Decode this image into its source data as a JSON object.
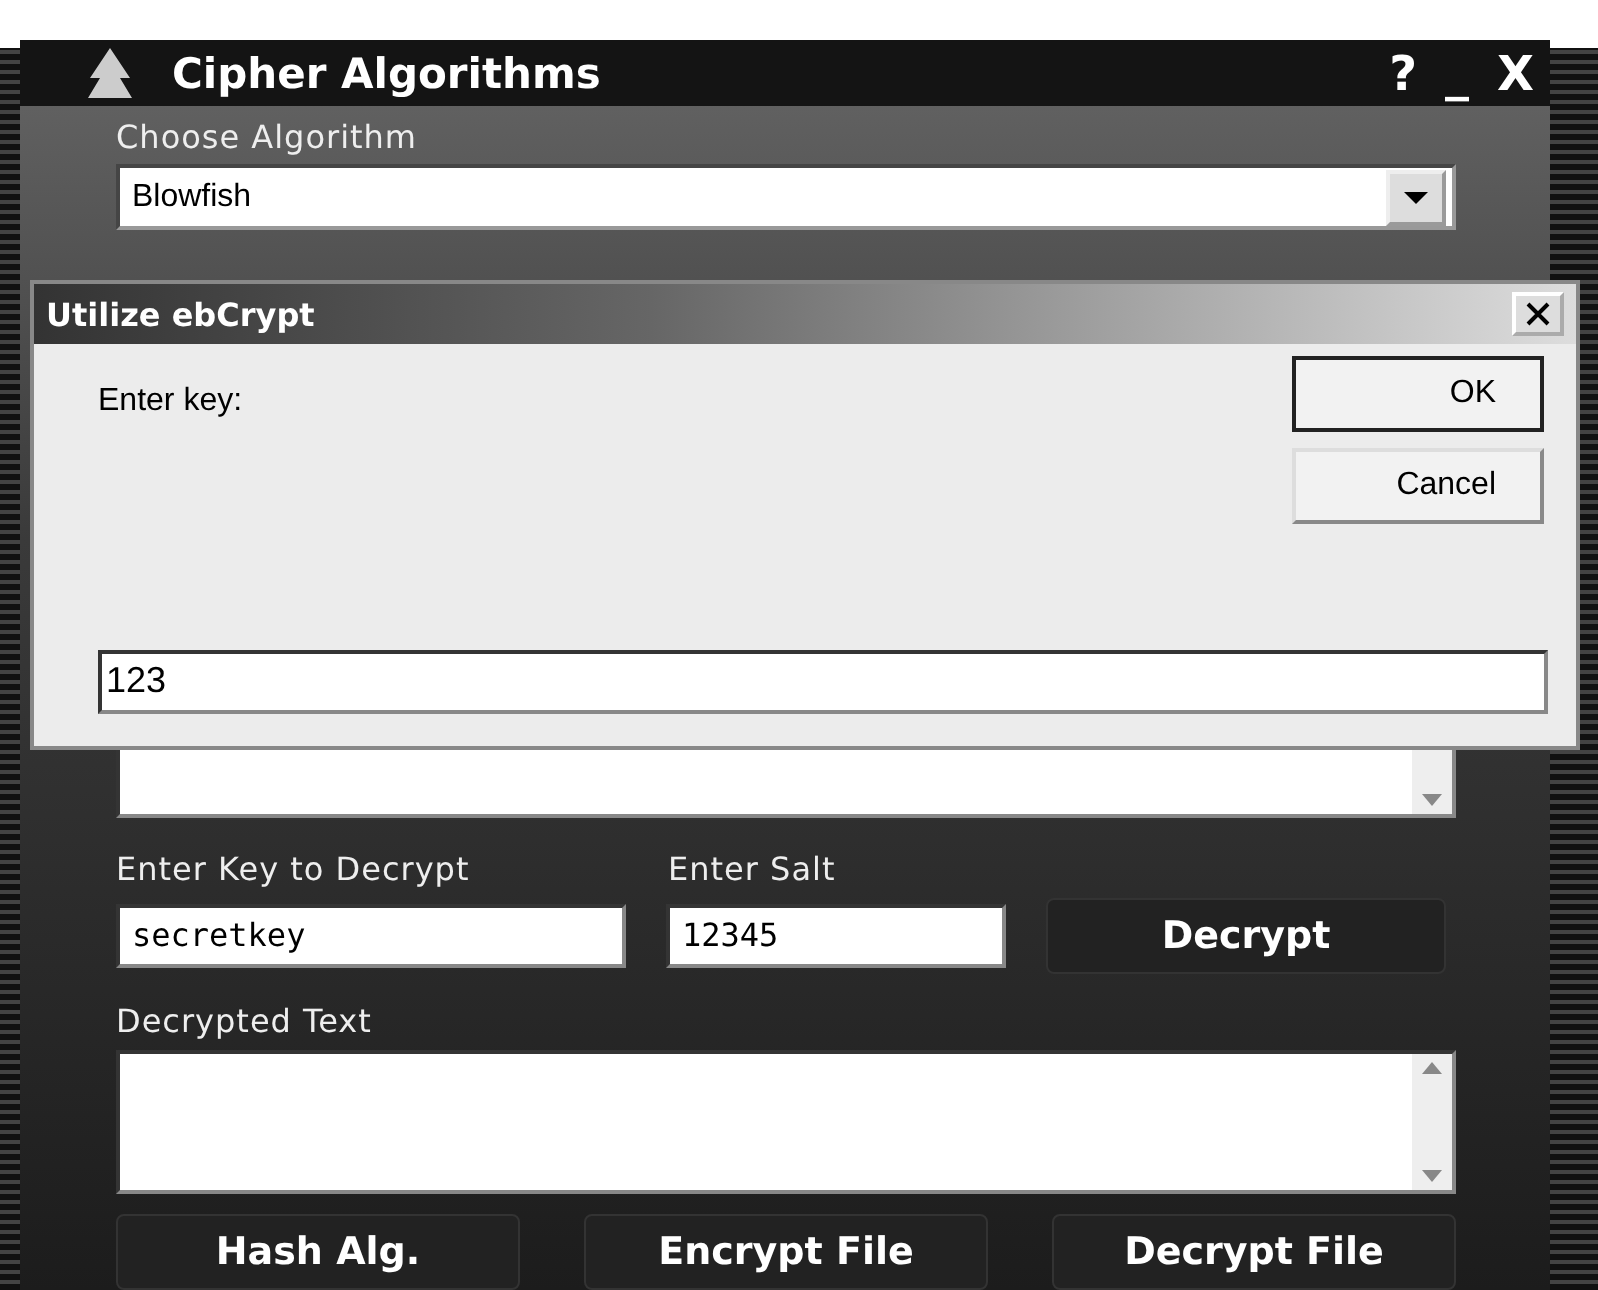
{
  "window": {
    "title": "Cipher Algorithms",
    "controls": [
      "?",
      "_",
      "X"
    ]
  },
  "algorithm": {
    "label": "Choose Algorithm",
    "value": "Blowfish"
  },
  "decrypt": {
    "key_label": "Enter Key to Decrypt",
    "key_value": "secretkey",
    "salt_label": "Enter Salt",
    "salt_value": "12345",
    "button": "Decrypt"
  },
  "decrypted": {
    "label": "Decrypted Text"
  },
  "buttons": [
    "Hash Alg.",
    "Encrypt File",
    "Decrypt File"
  ],
  "dialog": {
    "title": "Utilize ebCrypt",
    "prompt": "Enter key:",
    "value": "123",
    "buttons": [
      {
        "label": "OK",
        "default": true
      },
      {
        "label": "Cancel",
        "default": false
      }
    ]
  }
}
